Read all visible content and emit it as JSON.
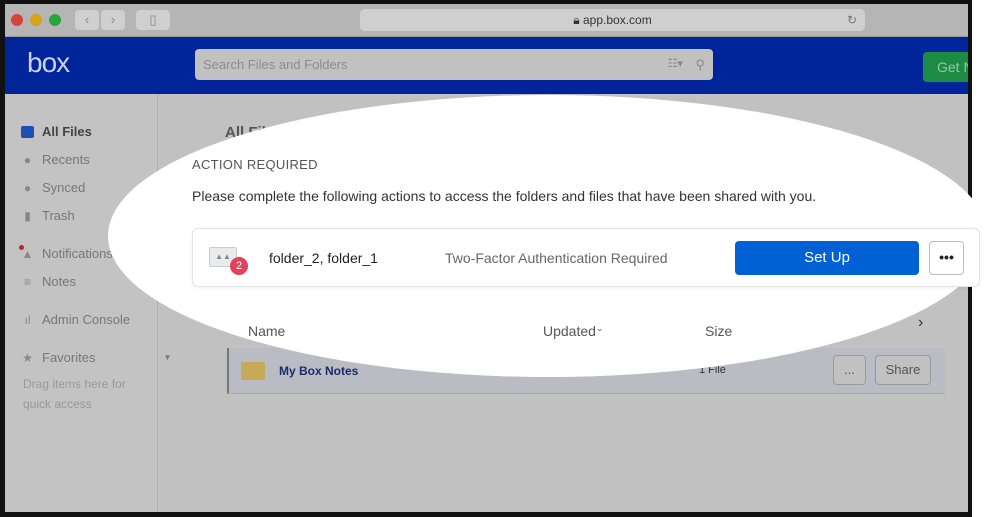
{
  "browser": {
    "url": "app.box.com"
  },
  "header": {
    "logo": "box",
    "search_placeholder": "Search Files and Folders",
    "get_button": "Get N"
  },
  "sidebar": {
    "items": [
      {
        "label": "All Files",
        "icon": "folder-icon"
      },
      {
        "label": "Recents",
        "icon": "clock-icon"
      },
      {
        "label": "Synced",
        "icon": "sync-icon"
      },
      {
        "label": "Trash",
        "icon": "trash-icon"
      },
      {
        "label": "Notifications",
        "icon": "bell-icon"
      },
      {
        "label": "Notes",
        "icon": "notes-icon"
      },
      {
        "label": "Admin Console",
        "icon": "chart-icon"
      },
      {
        "label": "Favorites",
        "icon": "star-icon"
      }
    ],
    "favorites_hint": "Drag items here for quick access"
  },
  "main": {
    "title": "All Files",
    "columns": [
      "Name",
      "Updated",
      "Size"
    ],
    "rows": [
      {
        "name": "My Box Notes",
        "size": "1 File",
        "more": "...",
        "share": "Share"
      }
    ]
  },
  "action": {
    "heading": "ACTION REQUIRED",
    "message": "Please complete the following actions to access the folders and files that have been shared with you.",
    "folders": "folder_2, folder_1",
    "badge": "2",
    "requirement": "Two-Factor Authentication Required",
    "setup_button": "Set Up",
    "more": "•••"
  },
  "colors": {
    "brand": "#00249a",
    "primary": "#0061d5",
    "badge": "#e5415b"
  }
}
